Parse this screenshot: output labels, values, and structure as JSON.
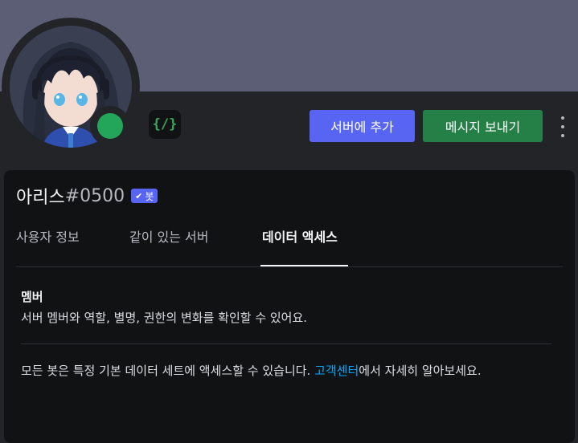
{
  "profile": {
    "username": "아리스",
    "discriminator": "#0500",
    "bot_tag": "봇",
    "status_color": "#23a55a",
    "banner_color": "#5b5e74",
    "badge_icon": "code-badge-icon",
    "badge_glyph": "{/}"
  },
  "actions": {
    "add_to_server": "서버에 추가",
    "send_message": "메시지 보내기",
    "more_icon": "more-vertical-icon"
  },
  "tabs": [
    {
      "label": "사용자 정보",
      "active": false
    },
    {
      "label": "같이 있는 서버",
      "active": false
    },
    {
      "label": "데이터 액세스",
      "active": true
    }
  ],
  "data_access": {
    "section_title": "멤버",
    "section_desc": "서버 멤버와 역할, 별명, 권한의 변화를 확인할 수 있어요.",
    "note_before": "모든 봇은 특정 기본 데이터 세트에 액세스할 수 있습니다. ",
    "note_link": "고객센터",
    "note_after": "에서 자세히 알아보세요."
  },
  "colors": {
    "accent": "#5865f2",
    "success": "#248046",
    "link": "#00a8fc"
  }
}
